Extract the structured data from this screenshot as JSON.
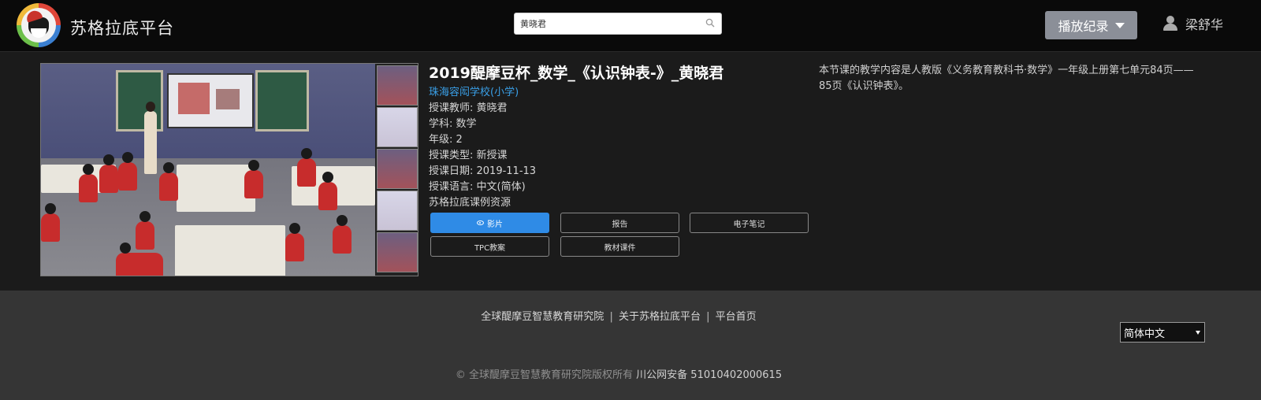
{
  "header": {
    "brand": "苏格拉底平台",
    "search_value": "黄晓君",
    "playlog_label": "播放纪录",
    "user_name": "梁舒华"
  },
  "lesson": {
    "title": "2019醍摩豆杯_数学_《认识钟表-》_黄晓君",
    "school": "珠海容闳学校(小学)",
    "teacher": "授课教师: 黄晓君",
    "subject": "学科: 数学",
    "grade": "年级: 2",
    "type": "授课类型: 新授课",
    "date": "授课日期: 2019-11-13",
    "language": "授课语言: 中文(简体)",
    "resource": "苏格拉底课例资源",
    "description": "本节课的教学内容是人教版《义务教育教科书·数学》一年级上册第七单元84页——85页《认识钟表》。"
  },
  "buttons": {
    "video": "影片",
    "report": "报告",
    "notes": "电子笔记",
    "tpc": "TPC教案",
    "courseware": "教材课件"
  },
  "footer": {
    "link1": "全球醍摩豆智慧教育研究院",
    "link2": "关于苏格拉底平台",
    "link3": "平台首页",
    "separator": "|",
    "language": "简体中文",
    "copyright": "© 全球醍摩豆智慧教育研究院版权所有",
    "icp": "川公网安备 51010402000615"
  },
  "colors": {
    "accent": "#2f8be6",
    "link": "#3aa0e8",
    "header_bg": "#0a0a0a",
    "footer_bg": "#353535"
  }
}
